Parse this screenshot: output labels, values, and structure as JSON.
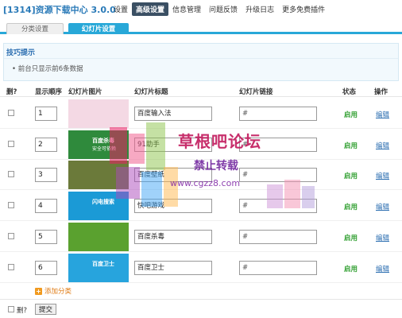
{
  "app": {
    "title": "[1314]资源下载中心 3.0.0"
  },
  "topnav": [
    {
      "label": "设置",
      "active": false
    },
    {
      "label": "高级设置",
      "active": true
    },
    {
      "label": "信息管理",
      "active": false
    },
    {
      "label": "问题反馈",
      "active": false
    },
    {
      "label": "升级日志",
      "active": false
    },
    {
      "label": "更多免费插件",
      "active": false
    }
  ],
  "tabs": [
    {
      "label": "分类设置",
      "active": false
    },
    {
      "label": "幻灯片设置",
      "active": true
    }
  ],
  "tip": {
    "title": "技巧提示",
    "text": "• 前台只显示前6条数据"
  },
  "table": {
    "headers": {
      "delete": "删?",
      "order": "显示顺序",
      "image": "幻灯片图片",
      "title": "幻灯片标题",
      "link": "幻灯片链接",
      "status": "状态",
      "action": "操作"
    },
    "rows": [
      {
        "order": "1",
        "title": "百度输入法",
        "link": "#",
        "status": "启用",
        "action": "编辑",
        "thumb_color": "#f4d9e4",
        "thumb_caption": "",
        "thumb_sub": ""
      },
      {
        "order": "2",
        "title": "91助手",
        "link": "#",
        "status": "启用",
        "action": "编辑",
        "thumb_color": "#2f8a3c",
        "thumb_caption": "百度杀毒",
        "thumb_sub": "安全可依赖"
      },
      {
        "order": "3",
        "title": "百度壁纸",
        "link": "#",
        "status": "启用",
        "action": "编辑",
        "thumb_color": "#6b7a3a",
        "thumb_caption": "",
        "thumb_sub": ""
      },
      {
        "order": "4",
        "title": "快吧游戏",
        "link": "#",
        "status": "启用",
        "action": "编辑",
        "thumb_color": "#1b9ad6",
        "thumb_caption": "闪电搜索",
        "thumb_sub": ""
      },
      {
        "order": "5",
        "title": "百度杀毒",
        "link": "#",
        "status": "启用",
        "action": "编辑",
        "thumb_color": "#5aa12f",
        "thumb_caption": "",
        "thumb_sub": ""
      },
      {
        "order": "6",
        "title": "百度卫士",
        "link": "#",
        "status": "启用",
        "action": "编辑",
        "thumb_color": "#27a4dd",
        "thumb_caption": "百度卫士",
        "thumb_sub": ""
      }
    ]
  },
  "add_label": "添加分类",
  "footer": {
    "delete_label": "删?",
    "submit_label": "提交"
  },
  "watermark": {
    "main": "草根吧论坛",
    "sub": "禁止转载",
    "url": "www.cgzz8.com"
  },
  "colors": {
    "accent": "#28a8d8",
    "nav_active": "#3a4f63",
    "status_green": "#2e9e2e",
    "link_blue": "#2a6db0",
    "add_orange": "#e07c16"
  }
}
